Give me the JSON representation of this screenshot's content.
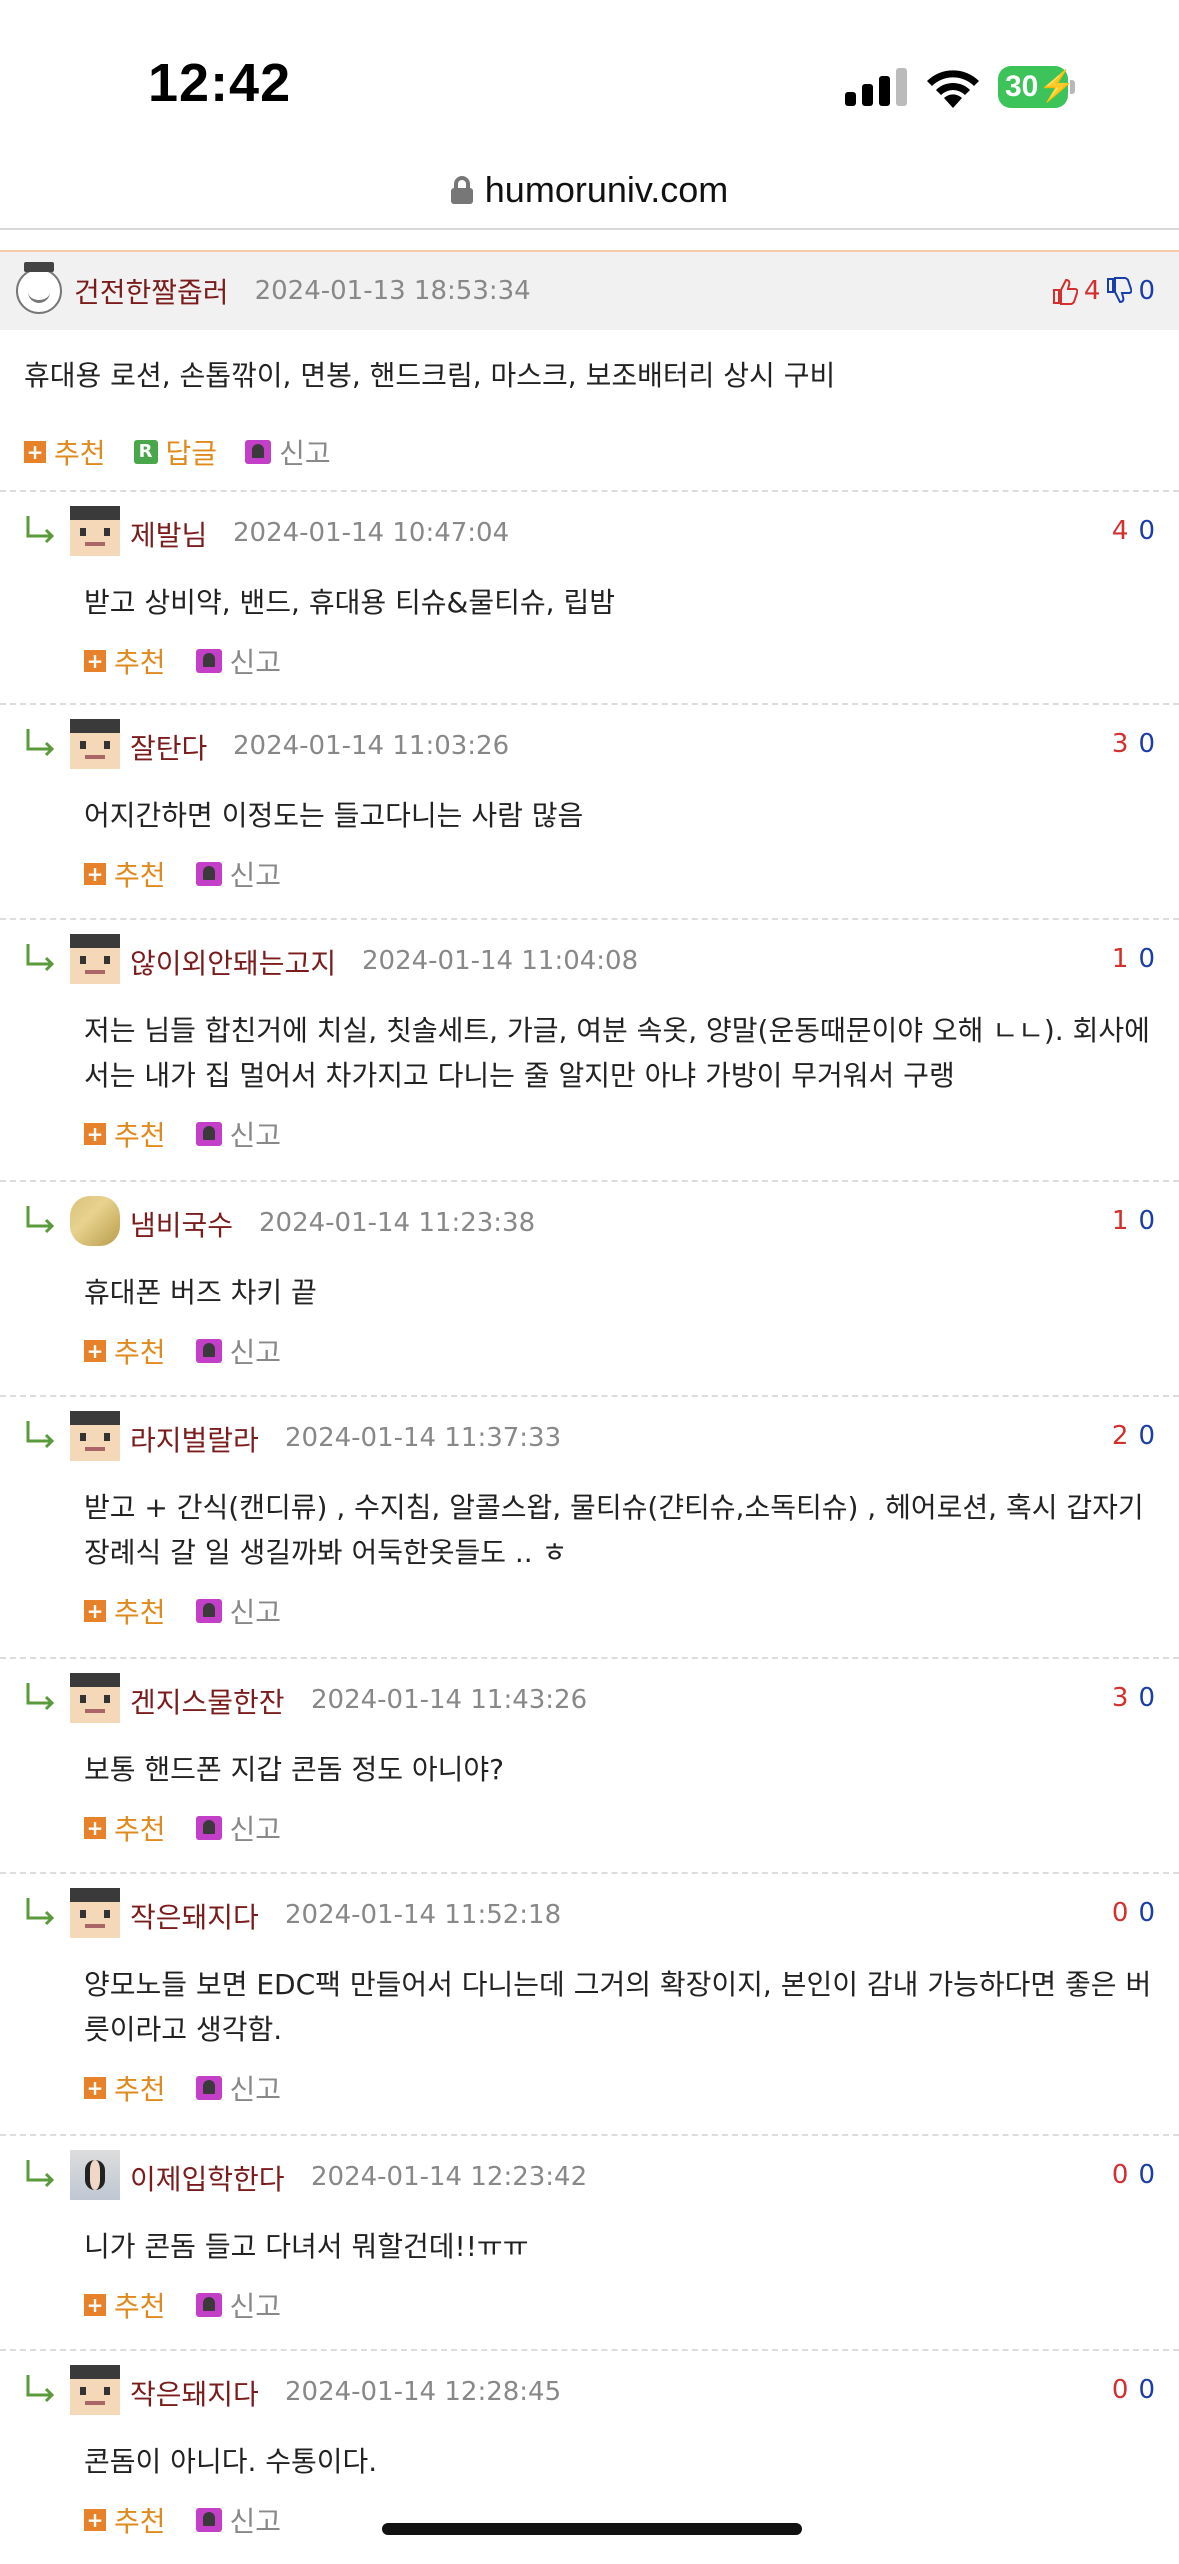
{
  "status": {
    "time": "12:42",
    "battery": "30"
  },
  "browser": {
    "url": "humoruniv.com"
  },
  "main_comment": {
    "nick": "건전한짤줍러",
    "date": "2024-01-13 18:53:34",
    "up": "4",
    "down": "0",
    "text": "휴대용 로션, 손톱깎이, 면봉, 핸드크림, 마스크, 보조배터리 상시 구비",
    "recommend_label": "추천",
    "reply_label": "답글",
    "report_label": "신고"
  },
  "labels": {
    "recommend": "추천",
    "report": "신고"
  },
  "replies": [
    {
      "nick": "제발님",
      "date": "2024-01-14 10:47:04",
      "up": "4",
      "down": "0",
      "text": "받고 상비약, 밴드, 휴대용 티슈&물티슈, 립밤"
    },
    {
      "nick": "잘탄다",
      "date": "2024-01-14 11:03:26",
      "up": "3",
      "down": "0",
      "text": "어지간하면 이정도는 들고다니는 사람 많음"
    },
    {
      "nick": "않이외안돼는고지",
      "date": "2024-01-14 11:04:08",
      "up": "1",
      "down": "0",
      "text": "저는 님들 합친거에 치실, 칫솔세트, 가글, 여분 속옷, 양말(운동때문이야 오해 ㄴㄴ). 회사에서는 내가 집 멀어서 차가지고 다니는 줄 알지만 아냐 가방이 무거워서 구랭"
    },
    {
      "nick": "냄비국수",
      "date": "2024-01-14 11:23:38",
      "up": "1",
      "down": "0",
      "text": "휴대폰 버즈 차키 끝"
    },
    {
      "nick": "라지벌랄라",
      "date": "2024-01-14 11:37:33",
      "up": "2",
      "down": "0",
      "text": "받고 + 간식(캔디류) , 수지침, 알콜스왑, 물티슈(갼티슈,소독티슈) , 헤어로션, 혹시 갑자기 장례식 갈 일 생길까봐 어둑한옷들도 .. ㅎ"
    },
    {
      "nick": "겐지스물한잔",
      "date": "2024-01-14 11:43:26",
      "up": "3",
      "down": "0",
      "text": "보통 핸드폰 지갑 콘돔 정도 아니야?"
    },
    {
      "nick": "작은돼지다",
      "date": "2024-01-14 11:52:18",
      "up": "0",
      "down": "0",
      "text": "양모노들 보면 EDC팩 만들어서 다니는데 그거의 확장이지, 본인이 감내 가능하다면 좋은 버릇이라고 생각함."
    },
    {
      "nick": "이제입학한다",
      "date": "2024-01-14 12:23:42",
      "up": "0",
      "down": "0",
      "text": "니가 콘돔 들고 다녀서 뭐할건데!!ㅠㅠ"
    },
    {
      "nick": "작은돼지다",
      "date": "2024-01-14 12:28:45",
      "up": "0",
      "down": "0",
      "text": "콘돔이 아니다. 수통이다."
    }
  ]
}
